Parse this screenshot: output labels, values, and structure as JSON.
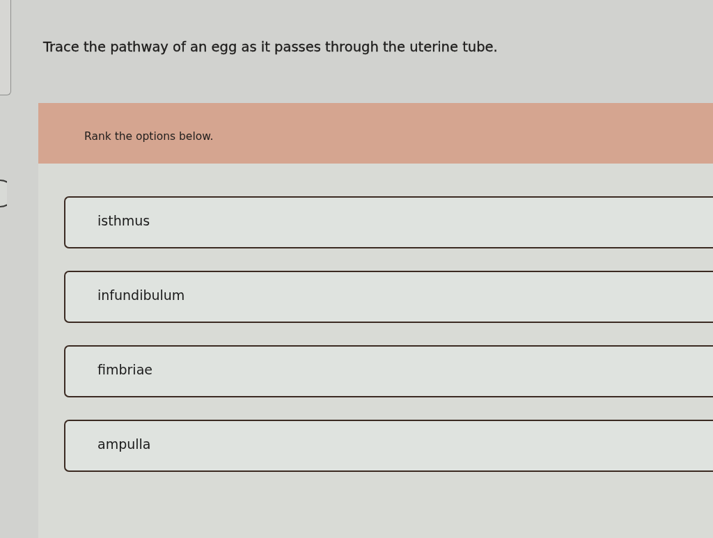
{
  "question": {
    "text": "Trace the pathway of an egg as it passes through the uterine tube."
  },
  "ranking": {
    "instruction": "Rank the options below.",
    "options": [
      {
        "label": "isthmus"
      },
      {
        "label": "infundibulum"
      },
      {
        "label": "fimbriae"
      },
      {
        "label": "ampulla"
      }
    ]
  }
}
